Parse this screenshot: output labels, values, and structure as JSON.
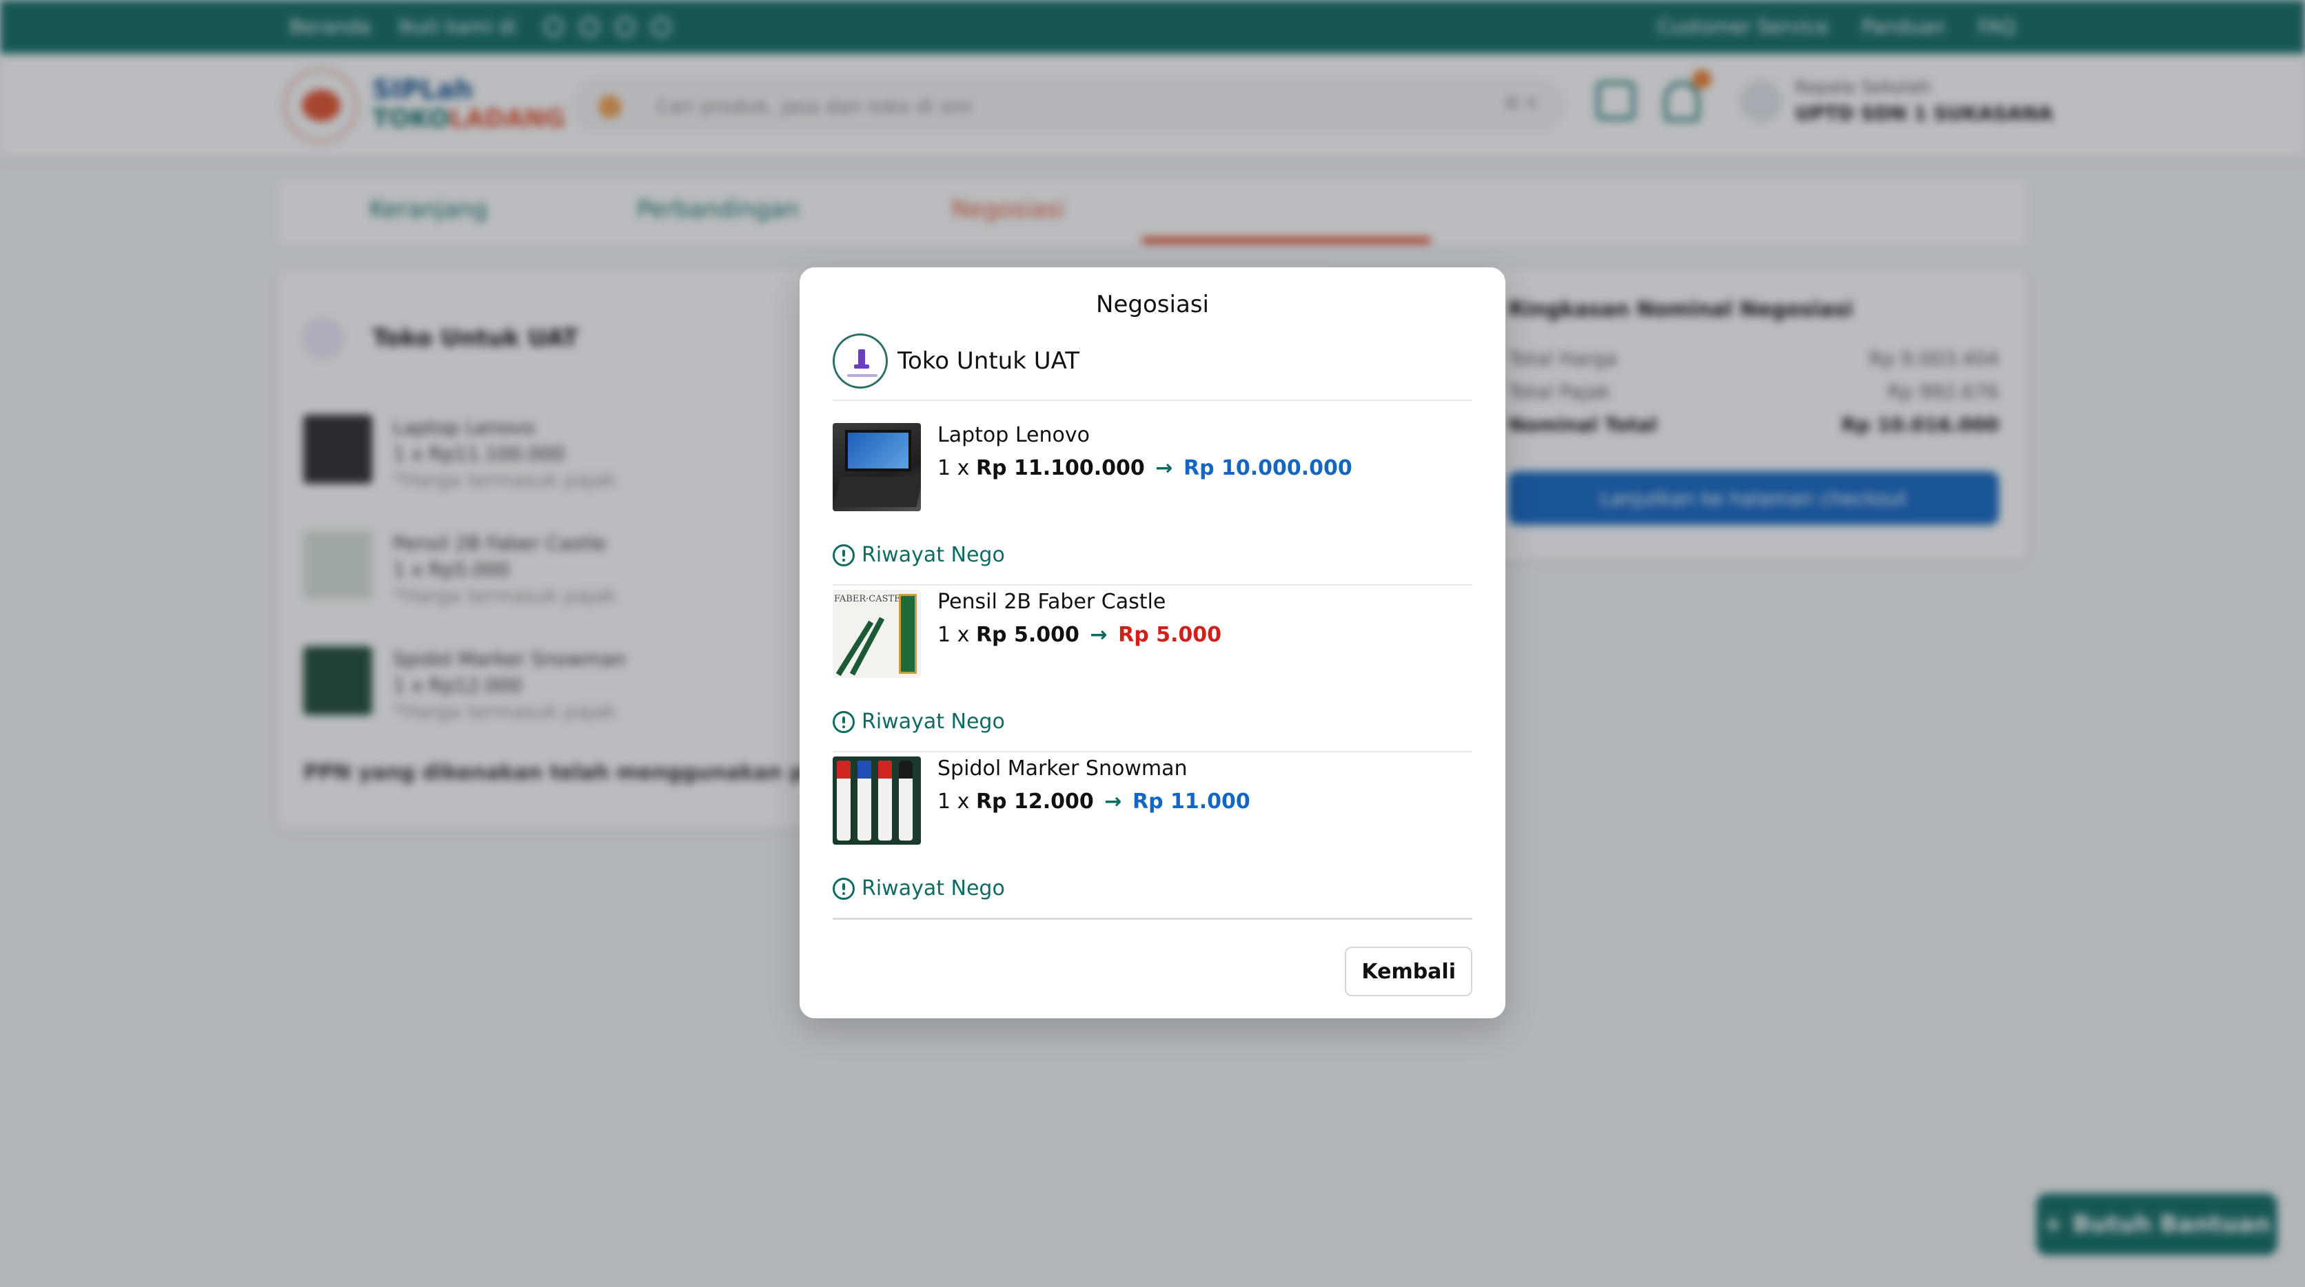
{
  "colors": {
    "primary": "#0e6b62",
    "accent": "#e4512c",
    "price_up_blue": "#1366c2",
    "price_red": "#d0201a"
  },
  "topbar": {
    "home": "Beranda",
    "follow": "Ikuti kami di",
    "links": [
      "Customer Service",
      "Panduan",
      "FAQ"
    ]
  },
  "header": {
    "logo_line1": "SIPLah",
    "logo_line2a": "TOKO",
    "logo_line2b": "LADANG",
    "search_placeholder": "Cari produk, jasa dan toko di sini",
    "search_shortcut": "⌘ K",
    "user_role": "Kepala Sekolah",
    "user_school": "UPTD SDN 1 SUKASANA"
  },
  "tabs": [
    "Keranjang",
    "Perbandingan",
    "Negosiasi"
  ],
  "cart": {
    "store_name": "Toko Untuk UAT",
    "items": [
      {
        "name": "Laptop Lenovo",
        "qty": "1 x Rp11.100.000",
        "note": "*Harga termasuk pajak"
      },
      {
        "name": "Pensil 2B Faber Castle",
        "qty": "1 x Rp5.000",
        "note": "*Harga termasuk pajak"
      },
      {
        "name": "Spidol Marker Snowman",
        "qty": "1 x Rp12.000",
        "note": "*Harga termasuk pajak"
      }
    ],
    "ppn_note": "PPN yang dikenakan telah menggunakan perhitungan"
  },
  "summary": {
    "title": "Ringkasan Nominal Negosiasi",
    "rows": [
      {
        "label": "Total Harga",
        "value": "Rp 9.003.404"
      },
      {
        "label": "Total Pajak",
        "value": "Rp 992.676"
      },
      {
        "label": "Nominal Total",
        "value": "Rp 10.016.000"
      }
    ],
    "button": "Lanjutkan ke halaman checkout"
  },
  "help_button": "Butuh Bantuan",
  "modal": {
    "title": "Negosiasi",
    "store_name": "Toko Untuk UAT",
    "history_label": "Riwayat Nego",
    "back_label": "Kembali",
    "items": [
      {
        "name": "Laptop Lenovo",
        "qty": "1 x",
        "old_price": "Rp 11.100.000",
        "new_price": "Rp 10.000.000",
        "new_color": "#1366c2"
      },
      {
        "name": "Pensil 2B Faber Castle",
        "qty": "1 x",
        "old_price": "Rp 5.000",
        "new_price": "Rp 5.000",
        "new_color": "#d0201a"
      },
      {
        "name": "Spidol Marker Snowman",
        "qty": "1 x",
        "old_price": "Rp 12.000",
        "new_price": "Rp 11.000",
        "new_color": "#1366c2"
      }
    ]
  }
}
